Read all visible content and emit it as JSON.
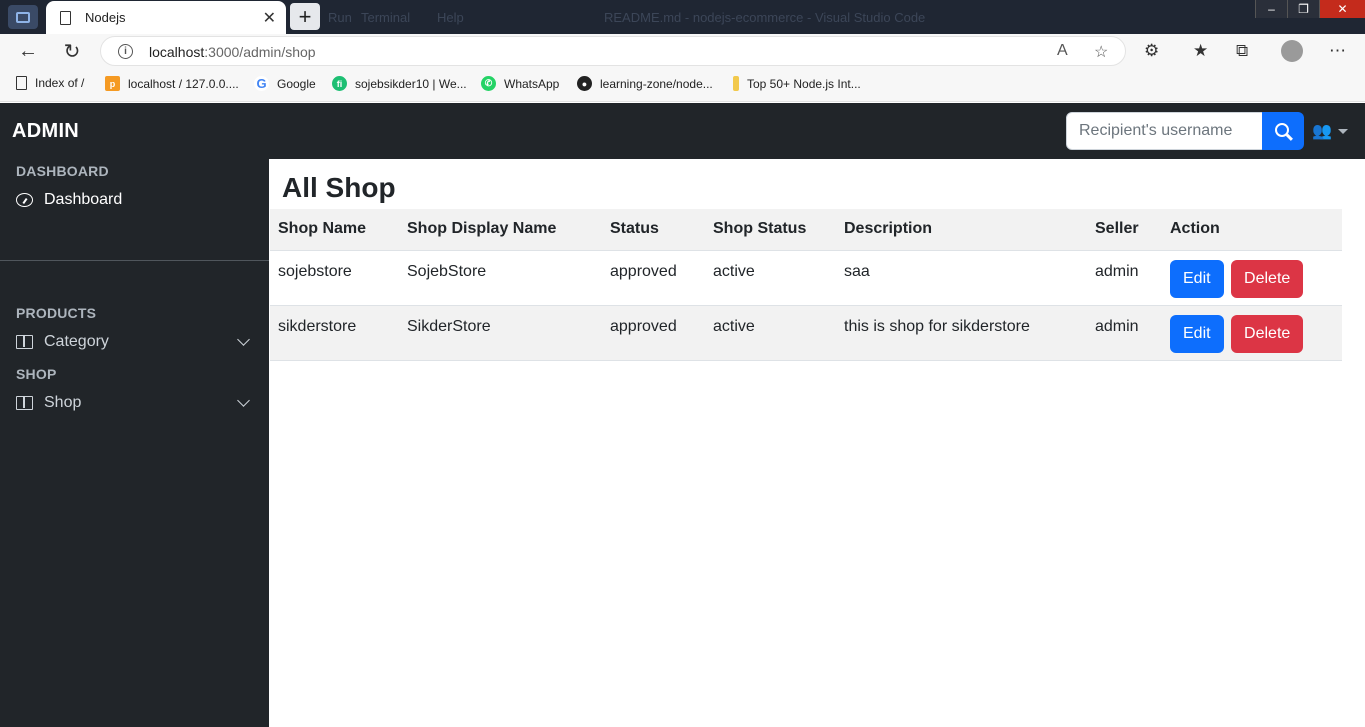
{
  "browser": {
    "tab_title": "Nodejs",
    "background_menu": [
      "Run",
      "Terminal",
      "Help"
    ],
    "background_title": "README.md - nodejs-ecommerce - Visual Studio Code",
    "url_host": "localhost",
    "url_rest": ":3000/admin/shop",
    "bookmarks": [
      {
        "label": "Index of /",
        "icon": "document-icon"
      },
      {
        "label": "localhost / 127.0.0....",
        "icon": "phpmyadmin-icon"
      },
      {
        "label": "Google",
        "icon": "google-icon"
      },
      {
        "label": "sojebsikder10 | We...",
        "icon": "fiverr-icon"
      },
      {
        "label": "WhatsApp",
        "icon": "whatsapp-icon"
      },
      {
        "label": "learning-zone/node...",
        "icon": "github-icon"
      },
      {
        "label": "Top 50+ Node.js Int...",
        "icon": "bookmark-icon"
      }
    ]
  },
  "navbar": {
    "brand": "ADMIN",
    "search_placeholder": "Recipient's username"
  },
  "sidebar": {
    "sections": [
      {
        "heading": "DASHBOARD",
        "items": [
          {
            "label": "Dashboard",
            "icon": "gauge-icon"
          }
        ]
      },
      {
        "heading": "PRODUCTS",
        "items": [
          {
            "label": "Category",
            "icon": "book-icon"
          }
        ]
      },
      {
        "heading": "SHOP",
        "items": [
          {
            "label": "Shop",
            "icon": "book-icon"
          }
        ]
      }
    ]
  },
  "main": {
    "title": "All Shop",
    "columns": [
      "Shop Name",
      "Shop Display Name",
      "Status",
      "Shop Status",
      "Description",
      "Seller",
      "Action"
    ],
    "rows": [
      {
        "shop_name": "sojebstore",
        "display_name": "SojebStore",
        "status": "approved",
        "shop_status": "active",
        "description": "saa",
        "seller": "admin"
      },
      {
        "shop_name": "sikderstore",
        "display_name": "SikderStore",
        "status": "approved",
        "shop_status": "active",
        "description": "this is shop for sikderstore",
        "seller": "admin"
      }
    ],
    "edit_label": "Edit",
    "delete_label": "Delete"
  },
  "colors": {
    "dark": "#212529",
    "primary": "#0d6efd",
    "danger": "#dc3545"
  }
}
